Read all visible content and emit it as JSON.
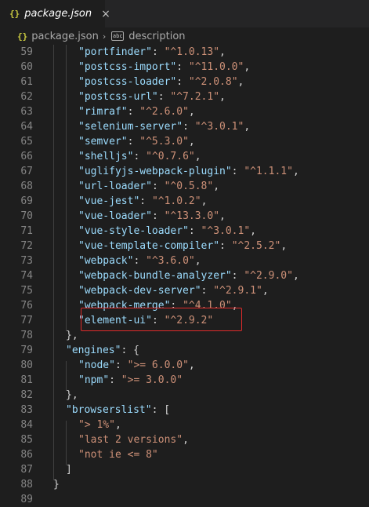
{
  "tab": {
    "label": "package.json",
    "icon": "{}",
    "close": "×"
  },
  "breadcrumb": {
    "file": "package.json",
    "icon": "{}",
    "separator": "›",
    "string_icon": "abc",
    "symbol": "description"
  },
  "lines": [
    {
      "num": "59",
      "indent": 2,
      "key": "portfinder",
      "value": "^1.0.13",
      "trail": ","
    },
    {
      "num": "60",
      "indent": 2,
      "key": "postcss-import",
      "value": "^11.0.0",
      "trail": ","
    },
    {
      "num": "61",
      "indent": 2,
      "key": "postcss-loader",
      "value": "^2.0.8",
      "trail": ","
    },
    {
      "num": "62",
      "indent": 2,
      "key": "postcss-url",
      "value": "^7.2.1",
      "trail": ","
    },
    {
      "num": "63",
      "indent": 2,
      "key": "rimraf",
      "value": "^2.6.0",
      "trail": ","
    },
    {
      "num": "64",
      "indent": 2,
      "key": "selenium-server",
      "value": "^3.0.1",
      "trail": ","
    },
    {
      "num": "65",
      "indent": 2,
      "key": "semver",
      "value": "^5.3.0",
      "trail": ","
    },
    {
      "num": "66",
      "indent": 2,
      "key": "shelljs",
      "value": "^0.7.6",
      "trail": ","
    },
    {
      "num": "67",
      "indent": 2,
      "key": "uglifyjs-webpack-plugin",
      "value": "^1.1.1",
      "trail": ","
    },
    {
      "num": "68",
      "indent": 2,
      "key": "url-loader",
      "value": "^0.5.8",
      "trail": ","
    },
    {
      "num": "69",
      "indent": 2,
      "key": "vue-jest",
      "value": "^1.0.2",
      "trail": ","
    },
    {
      "num": "70",
      "indent": 2,
      "key": "vue-loader",
      "value": "^13.3.0",
      "trail": ","
    },
    {
      "num": "71",
      "indent": 2,
      "key": "vue-style-loader",
      "value": "^3.0.1",
      "trail": ","
    },
    {
      "num": "72",
      "indent": 2,
      "key": "vue-template-compiler",
      "value": "^2.5.2",
      "trail": ","
    },
    {
      "num": "73",
      "indent": 2,
      "key": "webpack",
      "value": "^3.6.0",
      "trail": ","
    },
    {
      "num": "74",
      "indent": 2,
      "key": "webpack-bundle-analyzer",
      "value": "^2.9.0",
      "trail": ","
    },
    {
      "num": "75",
      "indent": 2,
      "key": "webpack-dev-server",
      "value": "^2.9.1",
      "trail": ","
    },
    {
      "num": "76",
      "indent": 2,
      "key": "webpack-merge",
      "value": "^4.1.0",
      "trail": ","
    },
    {
      "num": "77",
      "indent": 2,
      "key": "element-ui",
      "value": "^2.9.2",
      "trail": ""
    },
    {
      "num": "78",
      "indent": 1,
      "raw": "},"
    },
    {
      "num": "79",
      "indent": 1,
      "key": "engines",
      "open": "{"
    },
    {
      "num": "80",
      "indent": 2,
      "key": "node",
      "value": ">= 6.0.0",
      "trail": ","
    },
    {
      "num": "81",
      "indent": 2,
      "key": "npm",
      "value": ">= 3.0.0",
      "trail": ""
    },
    {
      "num": "82",
      "indent": 1,
      "raw": "},"
    },
    {
      "num": "83",
      "indent": 1,
      "key": "browserslist",
      "open": "["
    },
    {
      "num": "84",
      "indent": 2,
      "strval": "> 1%",
      "trail": ","
    },
    {
      "num": "85",
      "indent": 2,
      "strval": "last 2 versions",
      "trail": ","
    },
    {
      "num": "86",
      "indent": 2,
      "strval": "not ie <= 8",
      "trail": ""
    },
    {
      "num": "87",
      "indent": 1,
      "raw": "]"
    },
    {
      "num": "88",
      "indent": 0,
      "raw": "}"
    },
    {
      "num": "89",
      "indent": 0,
      "raw": ""
    }
  ],
  "colors": {
    "background": "#1e1e1e",
    "key": "#9cdcfe",
    "string": "#ce9178",
    "line_number": "#858585",
    "highlight_box": "#e02b2b"
  }
}
